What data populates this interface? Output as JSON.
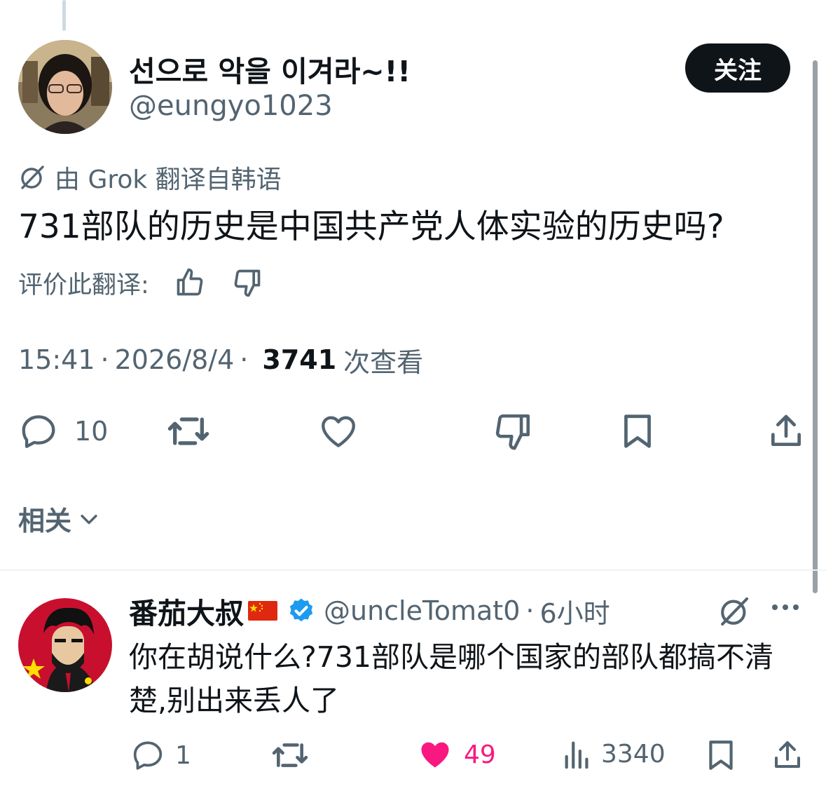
{
  "author": {
    "name": "선으로 악을 이겨라~!!",
    "handle": "@eungyo1023",
    "follow_label": "关注"
  },
  "tweet": {
    "translation_note": "由 Grok 翻译自韩语",
    "text": "731部队的历史是中国共产党人体实验的历史吗?",
    "rate_label": "评价此翻译:",
    "time": "15:41",
    "date": "2026/8/4",
    "separator": "·",
    "views": "3741",
    "views_label": "次查看",
    "reply_count": "10"
  },
  "related_label": "相关",
  "reply": {
    "name": "番茄大叔",
    "handle": "@uncleTomat0",
    "separator": "·",
    "time": "6小时",
    "text": "你在胡说什么?731部队是哪个国家的部队都搞不清楚,别出来丢人了",
    "reply_count": "1",
    "like_count": "49",
    "views": "3340"
  },
  "colors": {
    "text": "#0f1419",
    "secondary": "#536471",
    "like": "#f91880",
    "verified": "#1d9bf0",
    "divider": "#eff3f4"
  },
  "icons": [
    "grok-icon",
    "thumbs-up-icon",
    "thumbs-down-icon",
    "reply-icon",
    "retweet-icon",
    "heart-icon",
    "bookmark-icon",
    "share-icon",
    "chevron-down-icon",
    "verified-icon",
    "china-flag-icon",
    "more-icon",
    "views-icon"
  ]
}
